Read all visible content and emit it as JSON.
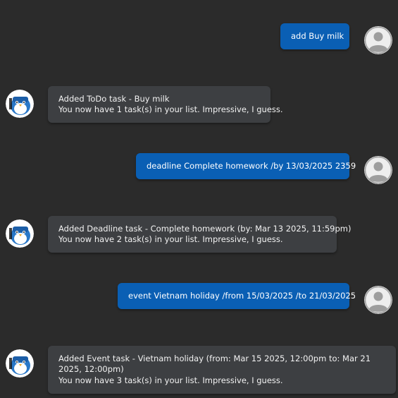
{
  "messages": [
    {
      "sender": "user",
      "lines": [
        "add Buy milk"
      ]
    },
    {
      "sender": "bot",
      "lines": [
        "Added ToDo task - Buy milk",
        "You now have 1 task(s) in your list. Impressive, I guess."
      ]
    },
    {
      "sender": "user",
      "lines": [
        "deadline Complete homework /by 13/03/2025 2359"
      ]
    },
    {
      "sender": "bot",
      "lines": [
        "Added Deadline task - Complete homework (by: Mar 13 2025, 11:59pm)",
        "You now have 2 task(s) in your list. Impressive, I guess."
      ]
    },
    {
      "sender": "user",
      "lines": [
        "event Vietnam holiday /from 15/03/2025 /to 21/03/2025"
      ]
    },
    {
      "sender": "bot",
      "lines": [
        "Added Event task - Vietnam holiday (from: Mar 15 2025, 12:00pm to: Mar 21 2025, 12:00pm)",
        "You now have 3 task(s) in your list. Impressive, I guess."
      ]
    }
  ],
  "colors": {
    "background": "#2b2b2b",
    "user_bubble": "#0a5fb4",
    "bot_bubble": "#3d3f42",
    "user_avatar_bg": "#eeeeee",
    "user_avatar_fg": "#9e9e9e"
  },
  "icons": {
    "user_avatar": "user-avatar-icon",
    "bot_avatar": "penguin-avatar-icon"
  }
}
